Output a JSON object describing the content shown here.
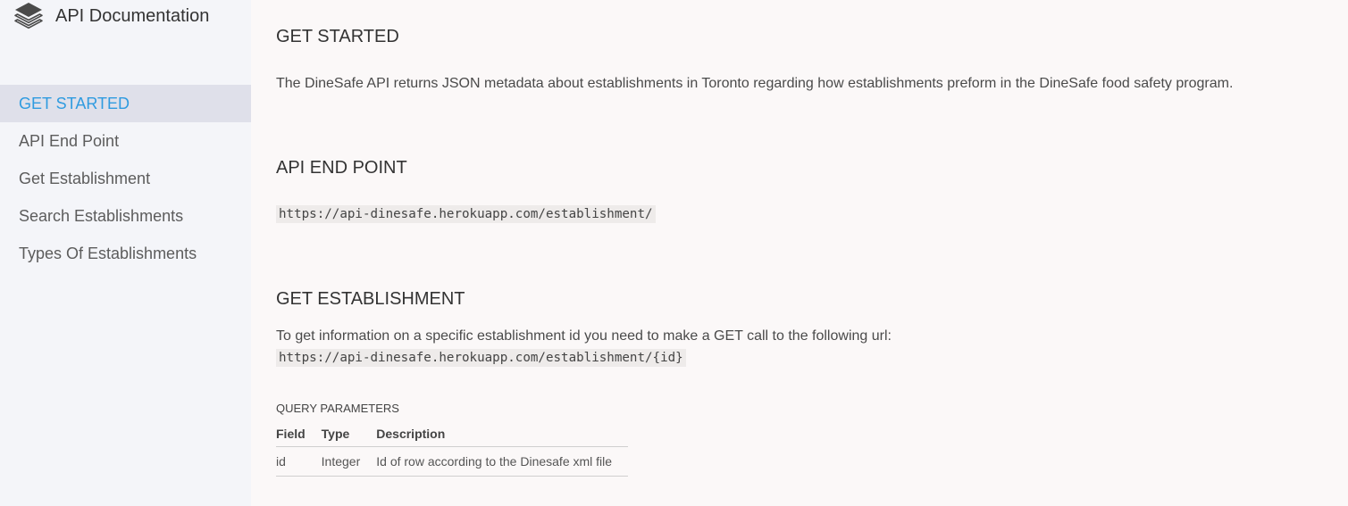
{
  "sidebar": {
    "brand": {
      "icon": "layers-icon",
      "title": "API Documentation"
    },
    "items": [
      {
        "label": "GET STARTED",
        "active": true
      },
      {
        "label": "API End Point",
        "active": false
      },
      {
        "label": "Get Establishment",
        "active": false
      },
      {
        "label": "Search Establishments",
        "active": false
      },
      {
        "label": "Types Of Establishments",
        "active": false
      }
    ]
  },
  "main": {
    "get_started": {
      "heading": "GET STARTED",
      "text": "The DineSafe API returns JSON metadata about establishments in Toronto regarding how establishments preform in the DineSafe food safety program."
    },
    "api_end_point": {
      "heading": "API END POINT",
      "url": "https://api-dinesafe.herokuapp.com/establishment/"
    },
    "get_establishment": {
      "heading": "GET ESTABLISHMENT",
      "text": "To get information on a specific establishment id you need to make a GET call to the following url:",
      "url": "https://api-dinesafe.herokuapp.com/establishment/{id}",
      "query_parameters_label": "QUERY PARAMETERS",
      "table": {
        "headers": [
          "Field",
          "Type",
          "Description"
        ],
        "rows": [
          [
            "id",
            "Integer",
            "Id of row according to the Dinesafe xml file"
          ]
        ]
      }
    }
  },
  "colors": {
    "accent": "#2f9be0",
    "sidebar_bg": "#f4f5f9",
    "active_bg": "#dfe0ea",
    "content_bg": "#fbf8f8"
  }
}
